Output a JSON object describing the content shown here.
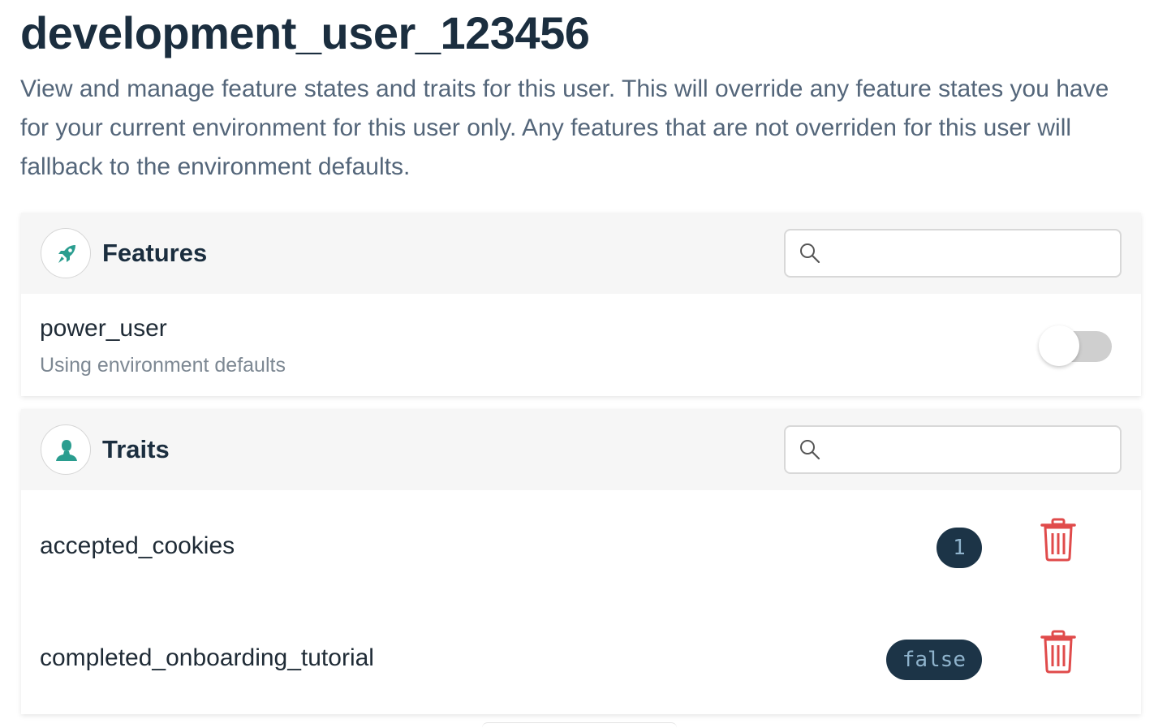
{
  "page": {
    "title": "development_user_123456",
    "description": "View and manage feature states and traits for this user. This will override any feature states you have for your current environment for this user only. Any features that are not overriden for this user will fallback to the environment defaults."
  },
  "features_panel": {
    "title": "Features",
    "icon": "rocket-icon",
    "search": {
      "value": "",
      "placeholder": ""
    },
    "items": [
      {
        "name": "power_user",
        "status": "Using environment defaults",
        "enabled": false
      }
    ]
  },
  "traits_panel": {
    "title": "Traits",
    "icon": "user-icon",
    "search": {
      "value": "",
      "placeholder": ""
    },
    "items": [
      {
        "key": "accepted_cookies",
        "value": "1"
      },
      {
        "key": "completed_onboarding_tutorial",
        "value": "false"
      }
    ]
  },
  "colors": {
    "accent": "#2a9d8f",
    "title": "#1b2e3f",
    "value_badge_bg": "#1c3447",
    "value_badge_text": "#8fb3cc",
    "delete": "#e04b4b",
    "toggle_off": "#cfcfcf"
  }
}
